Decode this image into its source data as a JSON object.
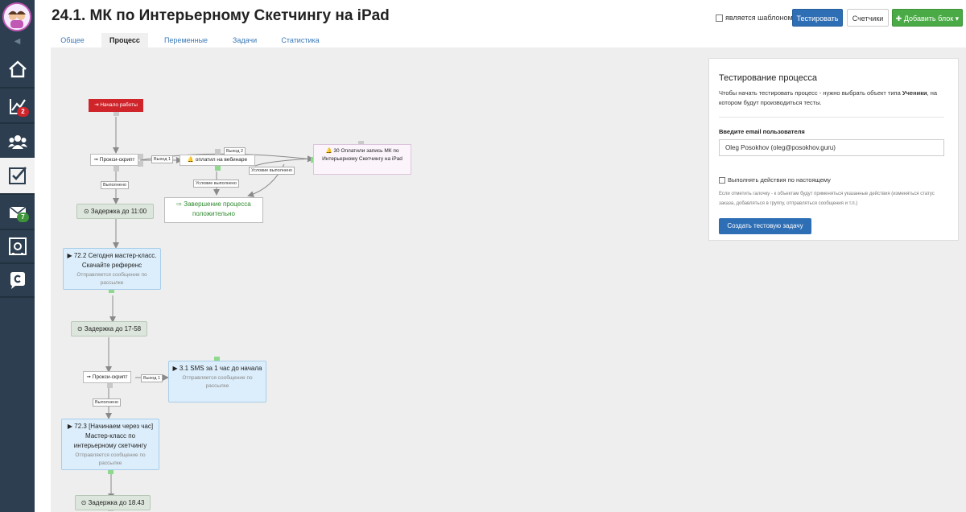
{
  "app": {
    "page_title": "24.1. МК по Интерьерному Скетчингу на iPad"
  },
  "sidebar": {
    "collapse_icon": "◀",
    "items": [
      {
        "name": "home",
        "badge": ""
      },
      {
        "name": "stats",
        "badge": "2",
        "badge_color": "#d0242b"
      },
      {
        "name": "users",
        "badge": ""
      },
      {
        "name": "tasks",
        "badge": ""
      },
      {
        "name": "messages",
        "badge": "7",
        "badge_color": "#3d9439"
      },
      {
        "name": "safe",
        "badge": ""
      },
      {
        "name": "chat",
        "badge": ""
      }
    ]
  },
  "header": {
    "template_label": "является шаблоном",
    "test_button": "Тестировать",
    "counters_button": "Счетчики",
    "add_block_button": "✚ Добавить блок ▾"
  },
  "tabs": [
    {
      "label": "Общее"
    },
    {
      "label": "Процесс"
    },
    {
      "label": "Переменные"
    },
    {
      "label": "Задачи"
    },
    {
      "label": "Статистика"
    }
  ],
  "flow": {
    "start": "⇥ Начало работы",
    "proxy1": "➞ Прокси-скрипт",
    "webinar": "🔔 оплатил на вебинаре",
    "paid": "🔔 30 Оплатили запись МК по Интерьерному Скетчингу на iPad",
    "done": "⇨ Завершение процесса положительно",
    "delay1": "⊙ Задержка до 11:00",
    "msg1_title": "▶ 72.2 Сегодня мастер-класс. Скачайте референс",
    "msg1_sub": "Отправляется сообщение по рассылке",
    "delay2": "⊙ Задержка до 17-58",
    "proxy2": "➞ Прокси-скрипт",
    "sms_title": "▶ 3.1 SMS за 1 час до начала",
    "sms_sub": "Отправляется сообщение по рассылке",
    "msg2_title": "▶ 72.3 [Начинаем через час] Мастер-класс по интерьерному скетчингу",
    "msg2_sub": "Отправляется сообщение по рассылке",
    "delay3": "⊙ Задержка до 18.43",
    "labels": {
      "vyhod1": "Выход 1",
      "vyhod2": "Выход 2",
      "vypolneno": "Выполнено",
      "uslovie": "Условие выполнено",
      "uslovie2": "Условие выполнено",
      "vypolneno2": "Выполнено",
      "vyhod1b": "Выход 1"
    }
  },
  "panel": {
    "title": "Тестирование процесса",
    "desc_prefix": "Чтобы начать тестировать процесс - нужно выбрать объект типа ",
    "desc_bold": "Ученики",
    "desc_suffix": ", на котором будут производиться тесты.",
    "email_label": "Введите email пользователя",
    "email_value": "Oleg Posokhov (oleg@posokhov.guru)",
    "checkbox_label": "Выполнять действия по настоящему",
    "hint": "Если отметить галочку - к объектам будут применяться указанные действия (изменяться статус заказа, добавляться в группу, отправляться сообщения и т.п.)",
    "create_button": "Создать тестовую задачу"
  }
}
